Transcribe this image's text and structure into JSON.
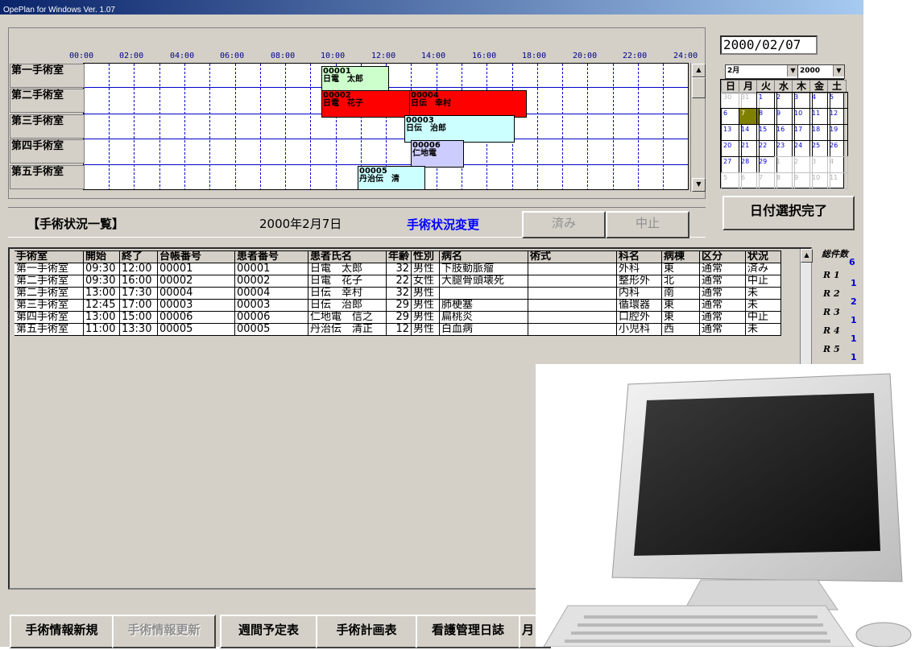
{
  "app": {
    "title": "OpePlan for Windows   Ver. 1.07"
  },
  "gantt": {
    "time_labels": [
      "00:00",
      "02:00",
      "04:00",
      "06:00",
      "08:00",
      "10:00",
      "12:00",
      "14:00",
      "16:00",
      "18:00",
      "20:00",
      "22:00",
      "24:00"
    ],
    "rooms": [
      "第一手術室",
      "第二手術室",
      "第三手術室",
      "第四手術室",
      "第五手術室"
    ],
    "bars": [
      {
        "id": "00001",
        "name": "日電　太郎",
        "color": "#ccffcc"
      },
      {
        "id": "00002",
        "name": "日電　花子",
        "color": "#ff0000"
      },
      {
        "id": "00004",
        "name": "日伝　幸村",
        "color": "#ff0000"
      },
      {
        "id": "00003",
        "name": "日伝　治郎",
        "color": "#ccffff"
      },
      {
        "id": "00006",
        "name": "仁地電",
        "color": "#ccccff"
      },
      {
        "id": "00005",
        "name": "丹治伝　清",
        "color": "#ccffff"
      }
    ]
  },
  "calendar": {
    "date_value": "2000/02/07",
    "month_select": "2月",
    "year_select": "2000",
    "weekdays": [
      "日",
      "月",
      "火",
      "水",
      "木",
      "金",
      "土"
    ],
    "days": [
      "30",
      "31",
      "1",
      "2",
      "3",
      "4",
      "5",
      "6",
      "7",
      "8",
      "9",
      "10",
      "11",
      "12",
      "13",
      "14",
      "15",
      "16",
      "17",
      "18",
      "19",
      "20",
      "21",
      "22",
      "23",
      "24",
      "25",
      "26",
      "27",
      "28",
      "29",
      "1",
      "2",
      "3",
      "4",
      "5",
      "6",
      "7",
      "8",
      "9",
      "10",
      "11"
    ],
    "selected_day": "7",
    "confirm_button": "日付選択完了"
  },
  "status": {
    "heading": "【手術状況一覧】",
    "date": "2000年2月7日",
    "change_label": "手術状況変更",
    "done_button": "済み",
    "cancel_button": "中止"
  },
  "table": {
    "columns": [
      "手術室",
      "開始",
      "終了",
      "台帳番号",
      "患者番号",
      "患者氏名",
      "年齢",
      "性別",
      "病名",
      "術式",
      "科名",
      "病棟",
      "区分",
      "状況"
    ],
    "rows": [
      [
        "第一手術室",
        "09:30",
        "12:00",
        "00001",
        "00001",
        "日電　太郎",
        "32",
        "男性",
        "下肢動脈瘤",
        "",
        "外科",
        "東",
        "通常",
        "済み"
      ],
      [
        "第二手術室",
        "09:30",
        "16:00",
        "00002",
        "00002",
        "日電　花子",
        "22",
        "女性",
        "大腿骨頭壊死",
        "",
        "整形外",
        "北",
        "通常",
        "中止"
      ],
      [
        "第二手術室",
        "13:00",
        "17:30",
        "00004",
        "00004",
        "日伝　幸村",
        "32",
        "男性",
        "",
        "",
        "内科",
        "南",
        "通常",
        "未"
      ],
      [
        "第三手術室",
        "12:45",
        "17:00",
        "00003",
        "00003",
        "日伝　治郎",
        "29",
        "男性",
        "肺梗塞",
        "",
        "循環器",
        "東",
        "通常",
        "未"
      ],
      [
        "第四手術室",
        "13:00",
        "15:00",
        "00006",
        "00006",
        "仁地電　信之",
        "29",
        "男性",
        "扁桃炎",
        "",
        "口腔外",
        "東",
        "通常",
        "中止"
      ],
      [
        "第五手術室",
        "11:00",
        "13:30",
        "00005",
        "00005",
        "丹治伝　清正",
        "12",
        "男性",
        "白血病",
        "",
        "小児科",
        "西",
        "通常",
        "未"
      ]
    ]
  },
  "counts": {
    "title": "総件数",
    "total": "6",
    "rooms": [
      {
        "label": "R 1",
        "value": "1"
      },
      {
        "label": "R 2",
        "value": "2"
      },
      {
        "label": "R 3",
        "value": "1"
      },
      {
        "label": "R 4",
        "value": "1"
      },
      {
        "label": "R 5",
        "value": "1"
      }
    ]
  },
  "bottom_buttons": [
    "手術情報新規",
    "手術情報更新",
    "週間予定表",
    "手術計画表",
    "看護管理日誌",
    "月"
  ]
}
